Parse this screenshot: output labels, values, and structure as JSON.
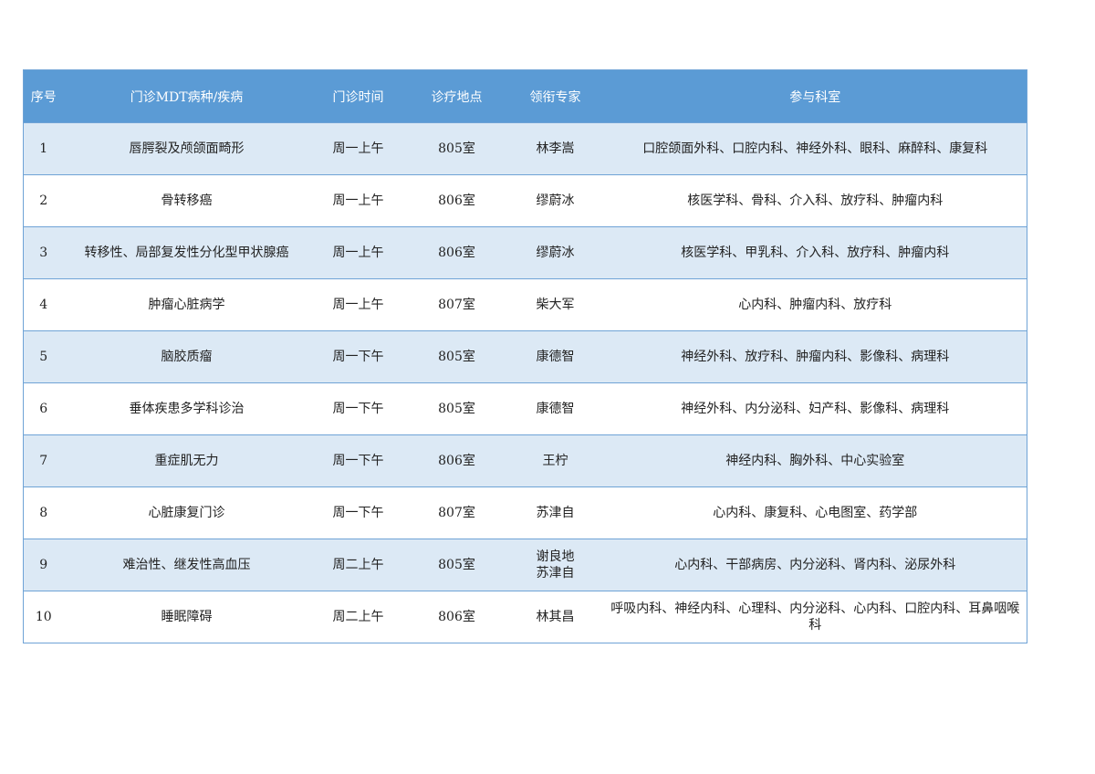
{
  "table": {
    "headers": [
      "序号",
      "门诊MDT病种/疾病",
      "门诊时间",
      "诊疗地点",
      "领衔专家",
      "参与科室"
    ],
    "rows": [
      {
        "no": "1",
        "disease": "唇腭裂及颅颌面畸形",
        "time": "周一上午",
        "place": "805室",
        "experts": [
          "林李嵩"
        ],
        "departments": "口腔颌面外科、口腔内科、神经外科、眼科、麻醉科、康复科"
      },
      {
        "no": "2",
        "disease": "骨转移癌",
        "time": "周一上午",
        "place": "806室",
        "experts": [
          "缪蔚冰"
        ],
        "departments": "核医学科、骨科、介入科、放疗科、肿瘤内科"
      },
      {
        "no": "3",
        "disease": "转移性、局部复发性分化型甲状腺癌",
        "time": "周一上午",
        "place": "806室",
        "experts": [
          "缪蔚冰"
        ],
        "departments": "核医学科、甲乳科、介入科、放疗科、肿瘤内科"
      },
      {
        "no": "4",
        "disease": "肿瘤心脏病学",
        "time": "周一上午",
        "place": "807室",
        "experts": [
          "柴大军"
        ],
        "departments": "心内科、肿瘤内科、放疗科"
      },
      {
        "no": "5",
        "disease": "脑胶质瘤",
        "time": "周一下午",
        "place": "805室",
        "experts": [
          "康德智"
        ],
        "departments": "神经外科、放疗科、肿瘤内科、影像科、病理科"
      },
      {
        "no": "6",
        "disease": "垂体疾患多学科诊治",
        "time": "周一下午",
        "place": "805室",
        "experts": [
          "康德智"
        ],
        "departments": "神经外科、内分泌科、妇产科、影像科、病理科"
      },
      {
        "no": "7",
        "disease": "重症肌无力",
        "time": "周一下午",
        "place": "806室",
        "experts": [
          "王柠"
        ],
        "departments": "神经内科、胸外科、中心实验室"
      },
      {
        "no": "8",
        "disease": "心脏康复门诊",
        "time": "周一下午",
        "place": "807室",
        "experts": [
          "苏津自"
        ],
        "departments": "心内科、康复科、心电图室、药学部"
      },
      {
        "no": "9",
        "disease": "难治性、继发性高血压",
        "time": "周二上午",
        "place": "805室",
        "experts": [
          "谢良地",
          "苏津自"
        ],
        "departments": "心内科、干部病房、内分泌科、肾内科、泌尿外科"
      },
      {
        "no": "10",
        "disease": "睡眠障碍",
        "time": "周二上午",
        "place": "806室",
        "experts": [
          "林其昌"
        ],
        "departments": "呼吸内科、神经内科、心理科、内分泌科、心内科、口腔内科、耳鼻咽喉科"
      }
    ]
  },
  "colors": {
    "header_bg": "#5b9bd5",
    "header_text": "#ffffff",
    "stripe_row": "#dce9f5",
    "border": "#6fa3d6"
  }
}
